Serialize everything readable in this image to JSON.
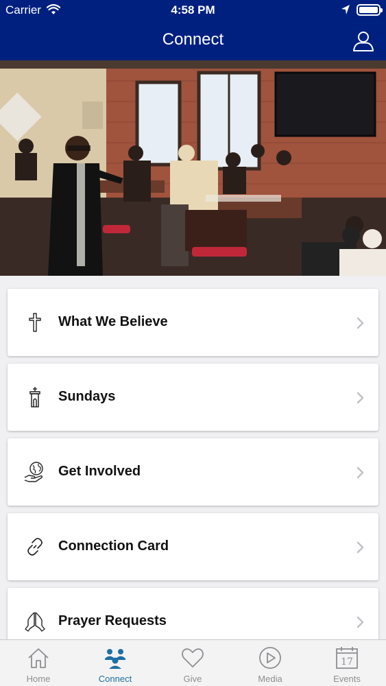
{
  "status_bar": {
    "carrier": "Carrier",
    "time": "4:58 PM"
  },
  "nav": {
    "title": "Connect",
    "profile_icon": "user-icon"
  },
  "hero": {
    "icon": "group-photo"
  },
  "items": [
    {
      "label": "What We Believe",
      "icon": "cross-icon"
    },
    {
      "label": "Sundays",
      "icon": "church-icon"
    },
    {
      "label": "Get Involved",
      "icon": "globe-hand-icon"
    },
    {
      "label": "Connection Card",
      "icon": "link-icon"
    },
    {
      "label": "Prayer Requests",
      "icon": "praying-hands-icon"
    }
  ],
  "tabs": [
    {
      "label": "Home",
      "icon": "home-icon",
      "active": false
    },
    {
      "label": "Connect",
      "icon": "people-icon",
      "active": true
    },
    {
      "label": "Give",
      "icon": "heart-icon",
      "active": false
    },
    {
      "label": "Media",
      "icon": "play-icon",
      "active": false
    },
    {
      "label": "Events",
      "icon": "calendar-icon",
      "active": false,
      "badge": "17"
    }
  ],
  "colors": {
    "brand": "#002080",
    "active_tab": "#1d6fa5",
    "inactive_tab": "#8e8e93"
  }
}
